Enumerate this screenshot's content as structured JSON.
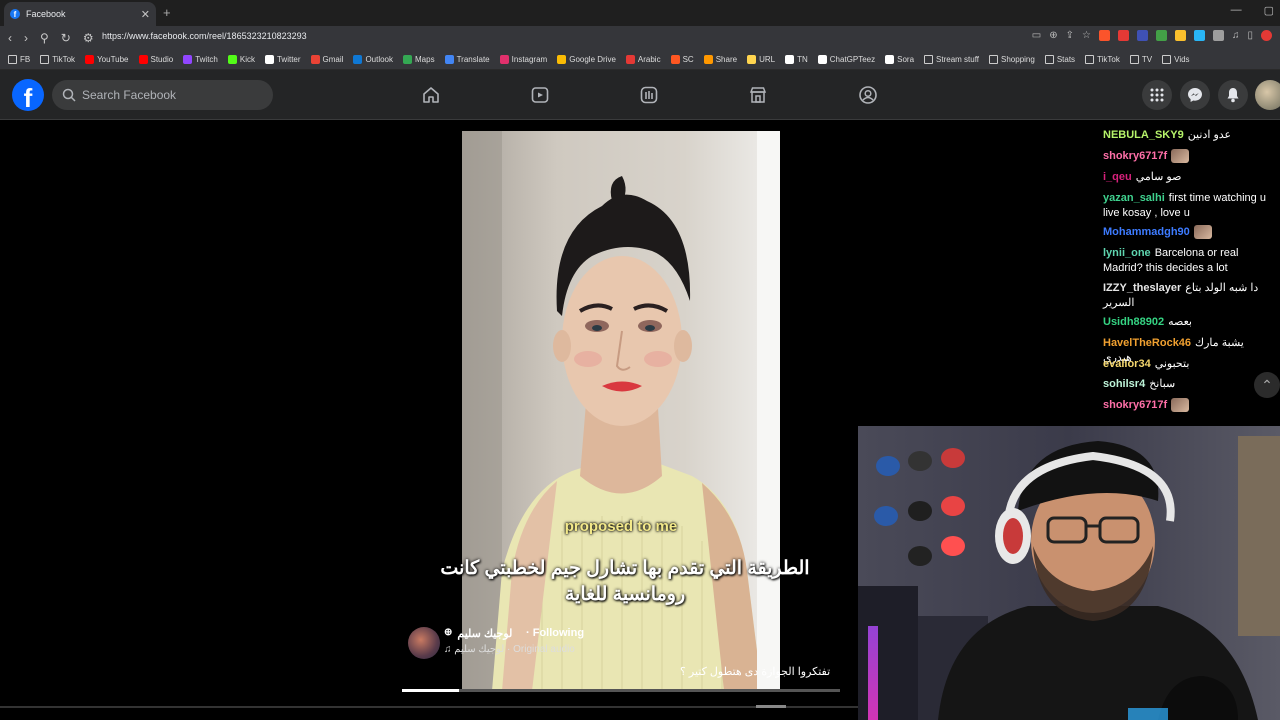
{
  "browser": {
    "tab_title": "Facebook",
    "url": "https://www.facebook.com/reel/1865323210823293",
    "bookmarks": [
      {
        "label": "FB",
        "icon": "folder-icon",
        "color": "#cccccc"
      },
      {
        "label": "TikTok",
        "icon": "folder-icon",
        "color": "#cccccc"
      },
      {
        "label": "YouTube",
        "icon": "youtube-icon",
        "color": "#ff0000"
      },
      {
        "label": "Studio",
        "icon": "youtube-studio-icon",
        "color": "#ff0000"
      },
      {
        "label": "Twitch",
        "icon": "twitch-icon",
        "color": "#9146ff"
      },
      {
        "label": "Kick",
        "icon": "kick-icon",
        "color": "#53fc18"
      },
      {
        "label": "Twitter",
        "icon": "x-icon",
        "color": "#ffffff"
      },
      {
        "label": "Gmail",
        "icon": "gmail-icon",
        "color": "#ea4335"
      },
      {
        "label": "Outlook",
        "icon": "outlook-icon",
        "color": "#0f78d4"
      },
      {
        "label": "Maps",
        "icon": "maps-icon",
        "color": "#34a853"
      },
      {
        "label": "Translate",
        "icon": "translate-icon",
        "color": "#4285f4"
      },
      {
        "label": "Instagram",
        "icon": "instagram-icon",
        "color": "#e1306c"
      },
      {
        "label": "Google Drive",
        "icon": "drive-icon",
        "color": "#fbbc04"
      },
      {
        "label": "Arabic",
        "icon": "arabic-icon",
        "color": "#e53935"
      },
      {
        "label": "SC",
        "icon": "sc-icon",
        "color": "#ff5722"
      },
      {
        "label": "Share",
        "icon": "share-icon",
        "color": "#ff9800"
      },
      {
        "label": "URL",
        "icon": "url-icon",
        "color": "#ffd54f"
      },
      {
        "label": "TN",
        "icon": "tn-icon",
        "color": "#ffffff"
      },
      {
        "label": "ChatGPTeez",
        "icon": "chatgpt-icon",
        "color": "#ffffff"
      },
      {
        "label": "Sora",
        "icon": "sora-icon",
        "color": "#ffffff"
      },
      {
        "label": "Stream stuff",
        "icon": "folder-icon",
        "color": "#cccccc"
      },
      {
        "label": "Shopping",
        "icon": "folder-icon",
        "color": "#cccccc"
      },
      {
        "label": "Stats",
        "icon": "folder-icon",
        "color": "#cccccc"
      },
      {
        "label": "TikTok",
        "icon": "folder-icon",
        "color": "#cccccc"
      },
      {
        "label": "TV",
        "icon": "folder-icon",
        "color": "#cccccc"
      },
      {
        "label": "Vids",
        "icon": "folder-icon",
        "color": "#cccccc"
      }
    ]
  },
  "facebook": {
    "search_placeholder": "Search Facebook",
    "accent": "#0866ff"
  },
  "reel": {
    "subtitle_en": "proposed to me",
    "subtitle_ar": "الطريقة التي تقدم بها تشارل جيم لخطبتي كانت رومانسية للغاية",
    "creator_name": "لوجيك سليم",
    "following_label": "· Following",
    "audio": "لوجيك سليم · Original audio",
    "caption": "تفتكروا الجوازة دى هتطول كتير ؟",
    "progress": 0.13
  },
  "chat": [
    {
      "user": "NEBULA_SKY9",
      "color": "#b6f36a",
      "text": "عدو ادنين"
    },
    {
      "user": "shokry6717f",
      "color": "#ff6fa8",
      "text": "",
      "emote": true
    },
    {
      "user": "i_qeu",
      "color": "#d8217c",
      "text": "صو سامي"
    },
    {
      "user": "yazan_salhi",
      "color": "#3fd18e",
      "text": "first time watching u live kosay , love u"
    },
    {
      "user": "Mohammadgh90",
      "color": "#3d7bff",
      "text": "",
      "emote": true
    },
    {
      "user": "lynii_one",
      "color": "#5fd6b0",
      "text": "Barcelona or real Madrid? this decides a lot"
    },
    {
      "user": "IZZY_theslayer",
      "color": "#e6e6e6",
      "text": "دا شبه الولد بتاع السرير"
    },
    {
      "user": "Usidh88902",
      "color": "#35d483",
      "text": "بعصه"
    },
    {
      "user": "HavelTheRock46",
      "color": "#f0a030",
      "text": "يشبة مارك هيدري"
    },
    {
      "user": "evalior34",
      "color": "#f5d76e",
      "text": "بتحبوني"
    },
    {
      "user": "sohilsr4",
      "color": "#bdf3d8",
      "text": "سبانخ"
    },
    {
      "user": "shokry6717f",
      "color": "#ff6fa8",
      "text": "",
      "emote": true
    }
  ]
}
